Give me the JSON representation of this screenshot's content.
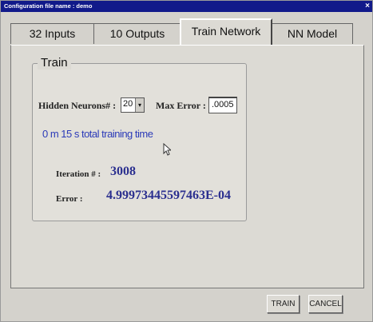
{
  "window": {
    "title": "Configuration file name : demo"
  },
  "tabs": [
    {
      "label": "32 Inputs",
      "active": false
    },
    {
      "label": "10 Outputs",
      "active": false
    },
    {
      "label": "Train Network",
      "active": true
    },
    {
      "label": "NN Model",
      "active": false
    }
  ],
  "train": {
    "group_title": "Train",
    "hidden_neurons_label": "Hidden Neurons# :",
    "hidden_neurons_value": "20",
    "max_error_label": "Max Error :",
    "max_error_value": ".0005",
    "total_time_text": "0 m  15 s total training time",
    "iteration_label": "Iteration # :",
    "iteration_value": "3008",
    "error_label": "Error :",
    "error_value": "4.99973445597463E-04"
  },
  "buttons": {
    "train": "TRAIN",
    "cancel": "CANCEL"
  },
  "icons": {
    "close": "close-icon",
    "spinner": "chevron-down-icon",
    "cursor": "mouse-pointer-icon"
  }
}
